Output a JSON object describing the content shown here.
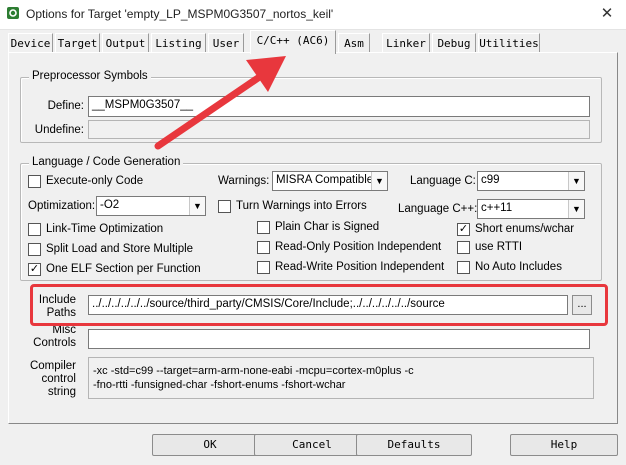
{
  "window": {
    "title": "Options for Target 'empty_LP_MSPM0G3507_nortos_keil'",
    "close_glyph": "✕",
    "app_icon": "keil-gear-icon"
  },
  "tabs": [
    {
      "label": "Device",
      "active": false
    },
    {
      "label": "Target",
      "active": false
    },
    {
      "label": "Output",
      "active": false
    },
    {
      "label": "Listing",
      "active": false
    },
    {
      "label": "User",
      "active": false
    },
    {
      "label": "C/C++ (AC6)",
      "active": true
    },
    {
      "label": "Asm",
      "active": false
    },
    {
      "label": "Linker",
      "active": false
    },
    {
      "label": "Debug",
      "active": false
    },
    {
      "label": "Utilities",
      "active": false
    }
  ],
  "preprocessor": {
    "title": "Preprocessor Symbols",
    "define_label": "Define:",
    "define_value": "__MSPM0G3507__",
    "undefine_label": "Undefine:",
    "undefine_value": ""
  },
  "language": {
    "title": "Language / Code Generation",
    "execute_only": {
      "label": "Execute-only Code",
      "checked": false
    },
    "warnings": {
      "label": "Warnings:",
      "value": "MISRA Compatible"
    },
    "language_c": {
      "label": "Language C:",
      "value": "c99"
    },
    "optimization": {
      "label": "Optimization:",
      "value": "-O2"
    },
    "turn_warnings": {
      "label": "Turn Warnings into Errors",
      "checked": false
    },
    "language_cpp": {
      "label": "Language C++:",
      "value": "c++11"
    },
    "link_time": {
      "label": "Link-Time Optimization",
      "checked": false
    },
    "plain_char": {
      "label": "Plain Char is Signed",
      "checked": false
    },
    "short_enums": {
      "label": "Short enums/wchar",
      "checked": true
    },
    "split_load": {
      "label": "Split Load and Store Multiple",
      "checked": false
    },
    "ro_pos": {
      "label": "Read-Only Position Independent",
      "checked": false
    },
    "use_rtti": {
      "label": "use RTTI",
      "checked": false
    },
    "one_elf": {
      "label": "One ELF Section per Function",
      "checked": true
    },
    "rw_pos": {
      "label": "Read-Write Position Independent",
      "checked": false
    },
    "no_auto": {
      "label": "No Auto Includes",
      "checked": false
    }
  },
  "include": {
    "label_line1": "Include",
    "label_line2": "Paths",
    "value": "../../../../../../source/third_party/CMSIS/Core/Include;../../../../../../source",
    "browse_label": "..."
  },
  "misc": {
    "label_line1": "Misc",
    "label_line2": "Controls",
    "value": ""
  },
  "compiler": {
    "label_line1": "Compiler",
    "label_line2": "control",
    "label_line3": "string",
    "line1": "-xc -std=c99 --target=arm-arm-none-eabi -mcpu=cortex-m0plus -c",
    "line2": "-fno-rtti -funsigned-char -fshort-enums -fshort-wchar"
  },
  "buttons": {
    "ok": "OK",
    "cancel": "Cancel",
    "defaults": "Defaults",
    "help": "Help"
  },
  "check_glyph": "✓",
  "annotation_color": "#e8373d"
}
